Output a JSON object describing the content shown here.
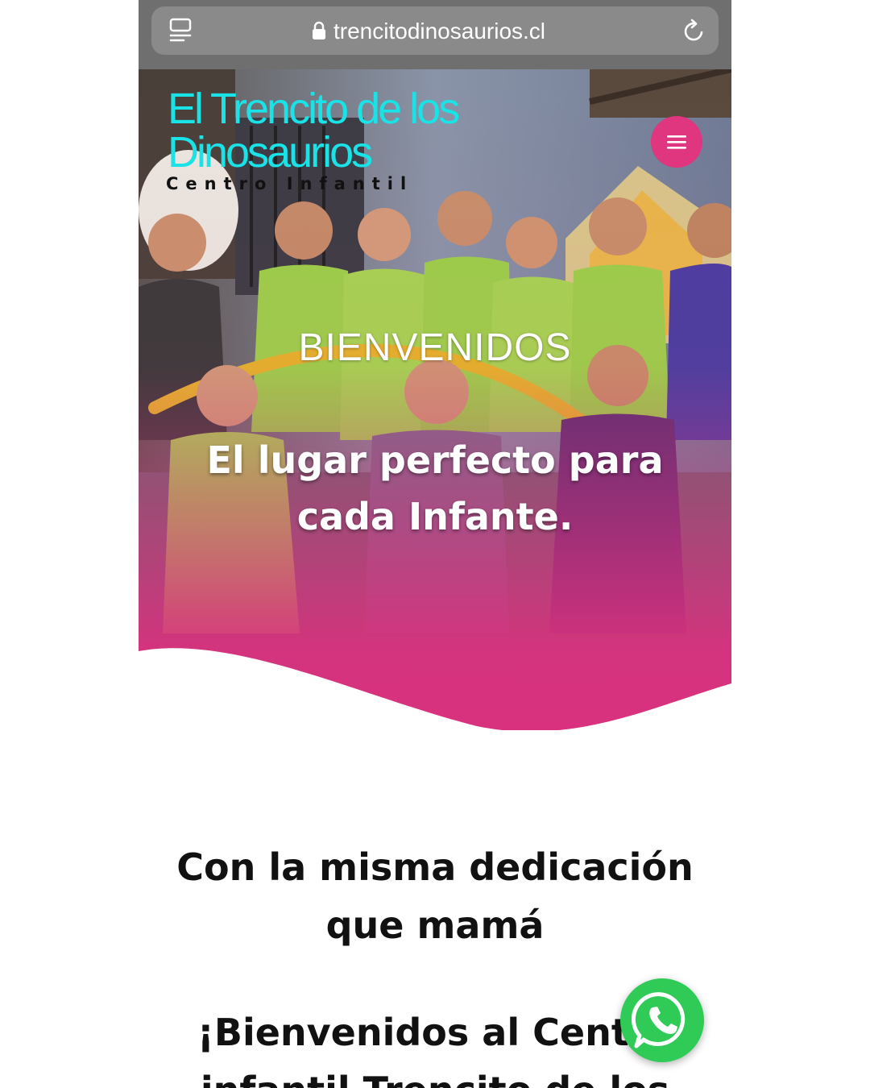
{
  "browser": {
    "url": "trencitodinosaurios.cl",
    "reader_icon": "reader-mode-icon",
    "lock_icon": "lock-icon",
    "reload_icon": "reload-icon"
  },
  "header": {
    "site_title": "El Trencito de los Dinosaurios",
    "site_tagline": "Centro Infantil",
    "title_color": "#19e3e6",
    "menu_icon": "hamburger-menu-icon",
    "menu_color": "#e0357f"
  },
  "hero": {
    "heading": "BIENVENIDOS",
    "subheading": "El lugar perfecto para cada Infante.",
    "overlay_color": "#d9317e"
  },
  "content": {
    "section_heading": "Con la misma dedicación que mamá",
    "welcome_heading": "¡Bienvenidos al Centro infantil Trencito de los"
  },
  "floating": {
    "whatsapp_icon": "whatsapp-icon",
    "whatsapp_color": "#2fcb56"
  }
}
